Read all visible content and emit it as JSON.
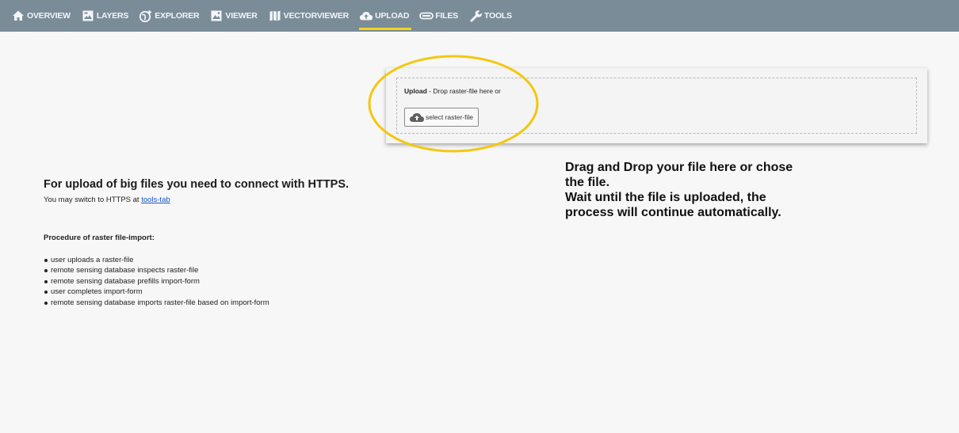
{
  "nav": {
    "items": [
      {
        "label": "OVERVIEW",
        "icon": "home-icon",
        "active": false
      },
      {
        "label": "LAYERS",
        "icon": "layers-icon",
        "active": false
      },
      {
        "label": "EXPLORER",
        "icon": "globe-plus-icon",
        "active": false
      },
      {
        "label": "VIEWER",
        "icon": "image-icon",
        "active": false
      },
      {
        "label": "VECTORVIEWER",
        "icon": "map-icon",
        "active": false
      },
      {
        "label": "UPLOAD",
        "icon": "cloud-upload-icon",
        "active": true
      },
      {
        "label": "FILES",
        "icon": "drive-icon",
        "active": false
      },
      {
        "label": "TOOLS",
        "icon": "wrench-icon",
        "active": false
      }
    ],
    "background": "#7b8c99",
    "active_indicator_color": "#f1d61b"
  },
  "upload": {
    "title": "Upload",
    "instruction": " - Drop raster-file here or",
    "select_button_label": "select raster-file",
    "select_button_icon": "cloud-upload-icon"
  },
  "annotation": {
    "lines": [
      "Drag and Drop your file here or chose",
      "the file.",
      "Wait until the file is uploaded, the",
      "process will continue automatically."
    ],
    "highlight_color": "#f4c70f"
  },
  "https": {
    "title": "For upload of big files you need to connect with HTTPS.",
    "note_prefix": "You may switch to HTTPS at ",
    "link_label": "tools-tab"
  },
  "procedure": {
    "title": "Procedure of raster file-import:",
    "steps": [
      "user uploads a raster-file",
      "remote sensing database inspects raster-file",
      "remote sensing database prefills import-form",
      "user completes import-form",
      "remote sensing database imports raster-file based on import-form"
    ]
  }
}
